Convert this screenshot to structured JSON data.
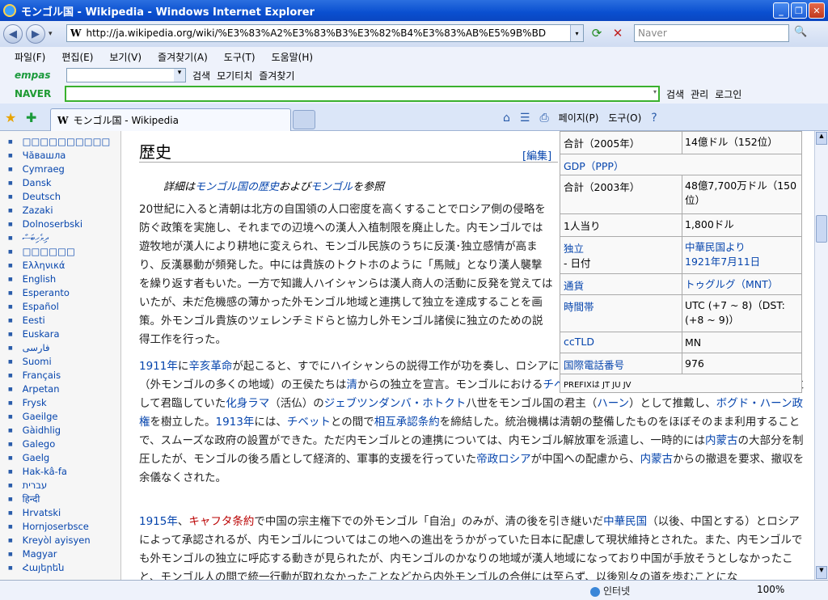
{
  "window": {
    "title": "モンゴル国 - Wikipedia - Windows Internet Explorer"
  },
  "address": {
    "url": "http://ja.wikipedia.org/wiki/%E3%83%A2%E3%83%B3%E3%82%B4%E3%83%AB%E5%9B%BD",
    "logo": "W"
  },
  "search": {
    "placeholder": "Naver"
  },
  "menu": [
    "파일(F)",
    "편집(E)",
    "보기(V)",
    "즐겨찾기(A)",
    "도구(T)",
    "도움말(H)"
  ],
  "empas": {
    "logo": "empas",
    "search_label": "검색",
    "gather": "모기티치",
    "favorites": "즐겨찾기"
  },
  "naver": {
    "logo": "NAVER",
    "search_label": "검색",
    "manage": "관리",
    "login": "로그인"
  },
  "tab": {
    "title": "モンゴル国 - Wikipedia"
  },
  "tabtools": {
    "page": "페이지(P)",
    "tools": "도구(O)"
  },
  "sidebar": [
    "□□□□□□□□□□",
    "Чăвашла",
    "Cymraeg",
    "Dansk",
    "Deutsch",
    "Zazaki",
    "Dolnoserbski",
    "ދިވެހިބަސް",
    "□□□□□□",
    "Ελληνικά",
    "English",
    "Esperanto",
    "Español",
    "Eesti",
    "Euskara",
    "فارسی",
    "Suomi",
    "Français",
    "Arpetan",
    "Frysk",
    "Gaeilge",
    "Gàidhlig",
    "Galego",
    "Gaelg",
    "Hak-kâ-fa",
    "עברית",
    "हिन्दी",
    "Hrvatski",
    "Hornjoserbsce",
    "Kreyòl ayisyen",
    "Magyar",
    "Հայերեն"
  ],
  "article": {
    "heading": "歴史",
    "edit": "[編集]",
    "seealso_prefix": "詳細は",
    "seealso_link1": "モンゴル国の歴史",
    "seealso_mid": "および",
    "seealso_link2": "モンゴル",
    "seealso_suffix": "を参照",
    "p1": "20世紀に入ると清朝は北方の自国領の人口密度を高くすることでロシア側の侵略を防ぐ政策を実施し、それまでの辺境への漢人入植制限を廃止した。内モンゴルでは遊牧地が漢人により耕地に変えられ、モンゴル民族のうちに反漢･独立感情が高まり、反漢暴動が頻発した。中には貴族のトクトホのように「馬賊」となり漢人襲撃を繰り返す者もいた。一方で知識人ハイシャンらは漢人商人の活動に反発を覚えてはいたが、未だ危機感の薄かった外モンゴル地域と連携して独立を達成することを画策。外モンゴル貴族のツェレンチミドらと協力し外モンゴル諸侯に独立のための説得工作を行った。",
    "p2a_link": "1911年",
    "p2a_mid": "に",
    "p2a_link2": "辛亥革命",
    "p2a_rest": "が起こると、すでにハイシャンらの説得工作が功を奏し、ロシアに独立のための財政援助を求めていたハルハ地方（外モンゴルの多くの地域）の王侯たちは",
    "p2a_link3": "清",
    "p2a_rest2": "からの独立を宣言。モンゴルにおける",
    "p2a_link4": "チベット仏教",
    "p2a_rest3": "界で最高権威かつ民族全体のシンボルとして君臨していた",
    "p2b_link": "化身ラマ",
    "p2b_mid": "（活仏）の",
    "p2b_link2": "ジェブツンダンバ・ホトクト",
    "p2b_rest": "八世をモンゴル国の君主（",
    "p2b_link3": "ハーン",
    "p2b_rest2": "）として推戴し、",
    "p2b_link4": "ボグド・ハーン政権",
    "p2b_rest3": "を樹立した。",
    "p2b_link5": "1913年",
    "p2b_rest4": "には、",
    "p2b_link6": "チベット",
    "p2b_rest5": "との間で",
    "p2b_link7": "相互承認条約",
    "p2b_rest6": "を締結した。統治機構は清朝の整備したものをほぼそのまま利用することで、スムーズな政府の設置ができた。ただ内モンゴルとの連携については、内モンゴル解放軍を派遣し、一時的には",
    "p2b_link8": "内蒙古",
    "p2b_rest7": "の大部分を制圧したが、モンゴルの後ろ盾として経済的、軍事的支援を行っていた",
    "p2b_link9": "帝政ロシア",
    "p2b_rest8": "が中国への配慮から、",
    "p2b_link10": "内蒙古",
    "p2b_rest9": "からの撤退を要求、撤収を余儀なくされた。",
    "p3_link": "1915年",
    "p3_mid": "、",
    "p3_link2": "キャフタ条約",
    "p3_rest": "で中国の宗主権下での外モンゴル「自治」のみが、清の後を引き継いだ",
    "p3_link3": "中華民国",
    "p3_rest2": "（以後、中国とする）とロシアによって承認されるが、内モンゴルについてはこの地への進出をうかがっていた日本に配慮して現状維持とされた。また、内モンゴルでも外モンゴルの独立に呼応する動きが見られたが、内モンゴルのかなりの地域が漢人地域になっており中国が手放そうとしなかったこと、モンゴル人の間で統一行動が取れなかったことなどから内外モンゴルの合併には至らず、以後別々の道を歩むことにな"
  },
  "infobox": {
    "r1k": "合計（2005年）",
    "r1v": "14億ドル（152位）",
    "r2k": "GDP（PPP）",
    "r3k": "合計（2003年）",
    "r3v": "48億7,700万ドル（150位）",
    "r4k": "1人当り",
    "r4v": "1,800ドル",
    "r5k": "独立",
    "r5k2": "- 日付",
    "r5v": "中華民国より",
    "r5v2": "1921年7月11日",
    "r6k": "通貨",
    "r6v": "トゥグルグ（MNT）",
    "r7k": "時間帯",
    "r7v": "UTC (+7 ~ 8)（DST: (+8 ~ 9)）",
    "r8k": "ccTLD",
    "r8v": "MN",
    "r9k": "国際電話番号",
    "r9v": "976",
    "r10": "PREFIXは  JT JU JV"
  },
  "status": {
    "zone": "인터넷",
    "zoom": "100%"
  }
}
